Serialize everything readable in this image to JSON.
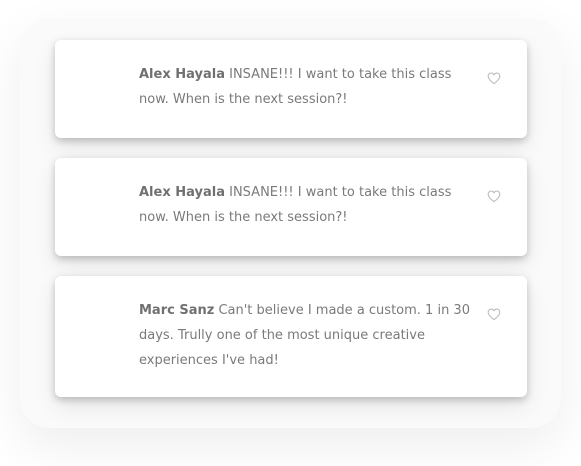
{
  "comments": [
    {
      "author": "Alex Hayala",
      "text": "INSANE!!! I want to take this class now. When is the next session?!"
    },
    {
      "author": "Alex Hayala",
      "text": "INSANE!!! I want to take this class now. When is the next session?!"
    },
    {
      "author": "Marc Sanz",
      "text": "Can't believe I made a custom. 1 in 30 days. Trully one of the most unique creative experiences I've had!"
    }
  ],
  "colors": {
    "author": "#707070",
    "text": "#7a7a7a",
    "icon": "#bdbdbd"
  },
  "icons": {
    "like": "heart-outline-icon"
  }
}
